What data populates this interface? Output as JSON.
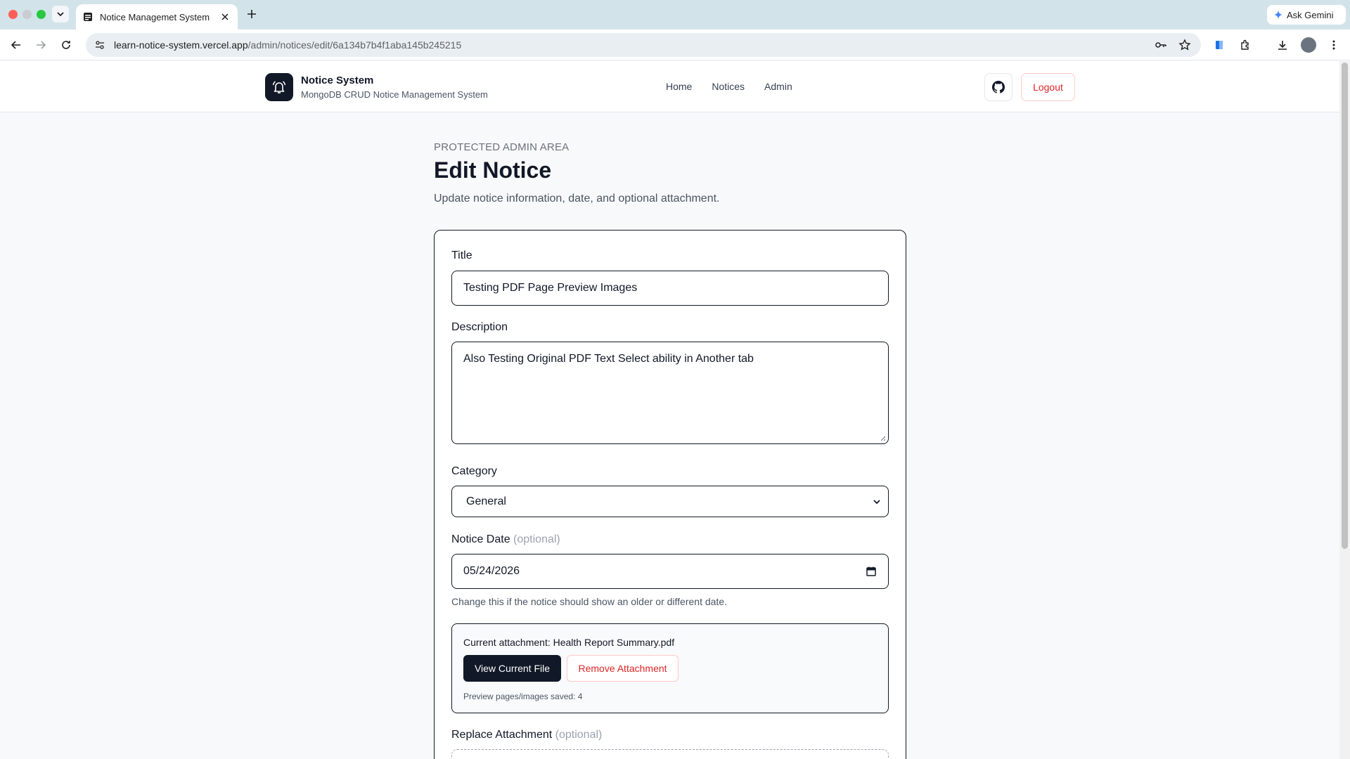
{
  "browser": {
    "tab_title": "Notice Managemet System",
    "url_host": "learn-notice-system.vercel.app",
    "url_path": "/admin/notices/edit/6a134b7b4f1aba145b245215",
    "gemini_label": "Ask Gemini"
  },
  "header": {
    "brand_name": "Notice System",
    "brand_subtitle": "MongoDB CRUD Notice Management System",
    "nav": [
      "Home",
      "Notices",
      "Admin"
    ],
    "logout_label": "Logout"
  },
  "page": {
    "eyebrow": "PROTECTED ADMIN AREA",
    "title": "Edit Notice",
    "subtitle": "Update notice information, date, and optional attachment."
  },
  "form": {
    "title_label": "Title",
    "title_value": "Testing PDF Page Preview Images",
    "description_label": "Description",
    "description_value": "Also Testing Original PDF Text Select ability in Another tab",
    "category_label": "Category",
    "category_value": "General",
    "date_label": "Notice Date",
    "optional_text": "(optional)",
    "date_value": "05/24/2026",
    "date_hint": "Change this if the notice should show an older or different date.",
    "attachment": {
      "current_text": "Current attachment: Health Report Summary.pdf",
      "view_label": "View Current File",
      "remove_label": "Remove Attachment",
      "saved_text": "Preview pages/images saved: 4"
    },
    "replace_label": "Replace Attachment",
    "replace_optional": "(optional)"
  },
  "colors": {
    "accent_dark": "#111827",
    "danger": "#dc2626",
    "tabbar": "#d3e3ea"
  }
}
